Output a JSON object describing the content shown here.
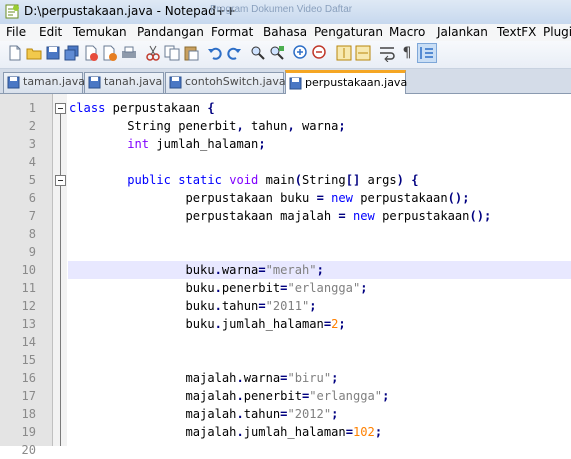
{
  "window": {
    "title": "D:\\perpustakaan.java - Notepad++",
    "ghost_text": "Program  Dokumen  Video  Daftar"
  },
  "menu": [
    "File",
    "Edit",
    "Temukan",
    "Pandangan",
    "Format",
    "Bahasa",
    "Pengaturan",
    "Macro",
    "Jalankan",
    "TextFX",
    "Plugi"
  ],
  "toolbar": [
    "new-file-icon",
    "open-file-icon",
    "save-icon",
    "save-all-icon",
    "close-icon",
    "close-all-icon",
    "print-icon",
    "cut-icon",
    "copy-icon",
    "paste-icon",
    "undo-icon",
    "redo-icon",
    "find-icon",
    "replace-icon",
    "zoom-in-icon",
    "zoom-out-icon",
    "sync-vertical-icon",
    "sync-horizontal-icon",
    "word-wrap-icon",
    "show-all-chars-icon",
    "indent-guide-icon"
  ],
  "tabs": [
    {
      "label": "taman.java",
      "active": false
    },
    {
      "label": "tanah.java",
      "active": false
    },
    {
      "label": "contohSwitch.java",
      "active": false
    },
    {
      "label": "perpustakaan.java",
      "active": true
    }
  ],
  "editor": {
    "highlighted_line": 10,
    "lines": [
      {
        "n": "1",
        "text": "class perpustakaan {"
      },
      {
        "n": "2",
        "text": "        String penerbit, tahun, warna;"
      },
      {
        "n": "3",
        "text": "        int jumlah_halaman;"
      },
      {
        "n": "4",
        "text": ""
      },
      {
        "n": "5",
        "text": "        public static void main(String[] args) {"
      },
      {
        "n": "6",
        "text": "                perpustakaan buku = new perpustakaan();"
      },
      {
        "n": "7",
        "text": "                perpustakaan majalah = new perpustakaan();"
      },
      {
        "n": "8",
        "text": ""
      },
      {
        "n": "9",
        "text": ""
      },
      {
        "n": "10",
        "text": "                buku.warna=\"merah\";"
      },
      {
        "n": "11",
        "text": "                buku.penerbit=\"erlangga\";"
      },
      {
        "n": "12",
        "text": "                buku.tahun=\"2011\";"
      },
      {
        "n": "13",
        "text": "                buku.jumlah_halaman=2;"
      },
      {
        "n": "14",
        "text": ""
      },
      {
        "n": "15",
        "text": ""
      },
      {
        "n": "16",
        "text": "                majalah.warna=\"biru\";"
      },
      {
        "n": "17",
        "text": "                majalah.penerbit=\"erlangga\";"
      },
      {
        "n": "18",
        "text": "                majalah.tahun=\"2012\";"
      },
      {
        "n": "19",
        "text": "                majalah.jumlah_halaman=102;"
      },
      {
        "n": "20",
        "text": ""
      }
    ]
  },
  "colors": {
    "keyword": "#0000ff",
    "type": "#8000ff",
    "string": "#808080",
    "number": "#ff8000",
    "operator": "#000080",
    "active_tab_accent": "#f5a623",
    "current_line": "#e8e8ff"
  }
}
